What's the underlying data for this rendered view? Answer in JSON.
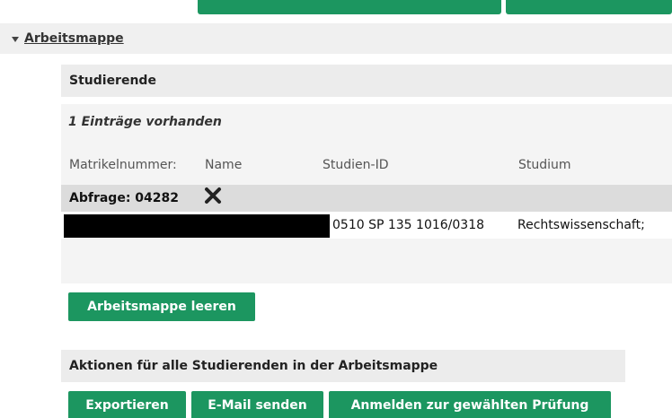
{
  "section": {
    "title": "Arbeitsmappe"
  },
  "students_panel": {
    "title": "Studierende",
    "entries_text": "1 Einträge vorhanden",
    "columns": [
      "Matrikelnummer:",
      "Name",
      "Studien-ID",
      "Studium"
    ],
    "query_label": "Abfrage: 04282",
    "rows": [
      {
        "studien_id": "0510 SP 135 1016/0318",
        "studium": "Rechtswissenschaft;"
      }
    ]
  },
  "clear_button": "Arbeitsmappe leeren",
  "actions_panel": {
    "title": "Aktionen für alle Studierenden in der Arbeitsmappe",
    "buttons": [
      "Exportieren",
      "E-Mail senden",
      "Anmelden zur gewählten Prüfung"
    ]
  },
  "colors": {
    "primary_button": "#1c9660",
    "panel_background": "#f4f4f4",
    "query_row_background": "#dcdcdc"
  }
}
